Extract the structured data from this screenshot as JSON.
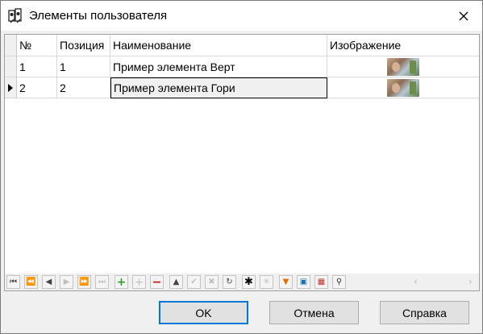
{
  "window": {
    "title": "Элементы пользователя"
  },
  "grid": {
    "columns": [
      "№",
      "Позиция",
      "Наименование",
      "Изображение"
    ],
    "rows": [
      {
        "num": "1",
        "position": "1",
        "name": "Пример элемента Верт"
      },
      {
        "num": "2",
        "position": "2",
        "name": "Пример элемента Гори"
      }
    ]
  },
  "toolbar": {
    "icons": [
      "first-icon",
      "prev-page-icon",
      "prev-icon",
      "next-icon",
      "next-page-icon",
      "last-icon",
      "add-icon",
      "add-copy-icon",
      "delete-icon",
      "move-up-icon",
      "check-icon",
      "cancel-icon",
      "refresh-icon",
      "asterisk-icon",
      "sparkle-icon",
      "filter-icon",
      "export-icon",
      "grid-settings-icon",
      "find-icon"
    ]
  },
  "buttons": {
    "ok": "OK",
    "cancel": "Отмена",
    "help": "Справка"
  },
  "colors": {
    "focus_border": "#0078d7",
    "add": "#2e9e2e",
    "delete": "#d00000"
  }
}
